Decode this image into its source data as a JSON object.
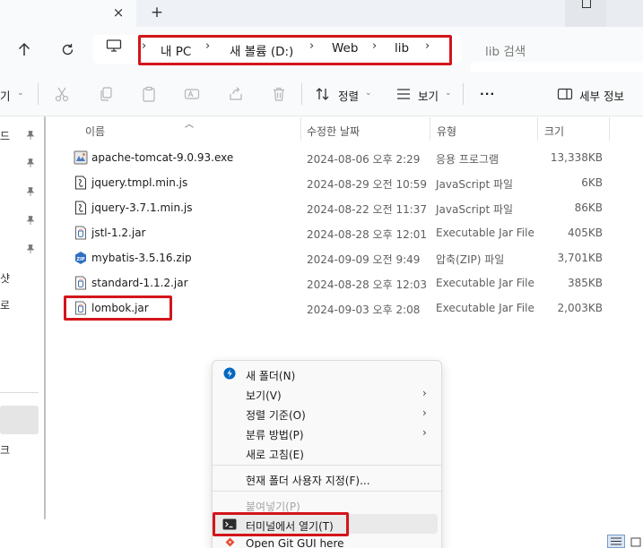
{
  "window": {
    "tab_close": "×",
    "new_tab": "+"
  },
  "address": {
    "crumbs": [
      "내 PC",
      "새 볼륨 (D:)",
      "Web",
      "lib"
    ],
    "separator": "›",
    "search_placeholder": "lib 검색"
  },
  "toolbar": {
    "new_label_partial": "기",
    "sort_label": "정렬",
    "view_label": "보기",
    "more": "···",
    "details_label": "세부 정보"
  },
  "navpane": {
    "chars": [
      "드",
      "샷",
      "로",
      "크"
    ]
  },
  "columns": {
    "name": "이름",
    "modified": "수정한 날짜",
    "type": "유형",
    "size": "크기"
  },
  "files": [
    {
      "name": "apache-tomcat-9.0.93.exe",
      "date": "2024-08-06 오후 2:29",
      "type": "응용 프로그램",
      "size": "13,338KB",
      "icon": "exe-icon"
    },
    {
      "name": "jquery.tmpl.min.js",
      "date": "2024-08-29 오전 10:59",
      "type": "JavaScript 파일",
      "size": "6KB",
      "icon": "js-file-icon"
    },
    {
      "name": "jquery-3.7.1.min.js",
      "date": "2024-08-22 오전 11:37",
      "type": "JavaScript 파일",
      "size": "86KB",
      "icon": "js-file-icon"
    },
    {
      "name": "jstl-1.2.jar",
      "date": "2024-08-28 오후 12:01",
      "type": "Executable Jar File",
      "size": "405KB",
      "icon": "jar-icon"
    },
    {
      "name": "mybatis-3.5.16.zip",
      "date": "2024-09-09 오전 9:49",
      "type": "압축(ZIP) 파일",
      "size": "3,701KB",
      "icon": "zip-icon"
    },
    {
      "name": "standard-1.1.2.jar",
      "date": "2024-08-28 오후 12:03",
      "type": "Executable Jar File",
      "size": "385KB",
      "icon": "jar-icon"
    },
    {
      "name": "lombok.jar",
      "date": "2024-09-03 오후 2:08",
      "type": "Executable Jar File",
      "size": "2,003KB",
      "icon": "jar-icon"
    }
  ],
  "context_menu": {
    "new_folder": "새 폴더(N)",
    "view": "보기(V)",
    "sort_by": "정렬 기준(O)",
    "group_by": "분류 방법(P)",
    "refresh": "새로 고침(E)",
    "customize": "현재 폴더 사용자 지정(F)...",
    "paste": "붙여넣기(P)",
    "open_terminal": "터미널에서 열기(T)",
    "open_git_gui": "Open Git GUI here",
    "submenu_arrow": "›"
  },
  "colors": {
    "highlight": "#d3151b",
    "accent": "#0067c0"
  }
}
